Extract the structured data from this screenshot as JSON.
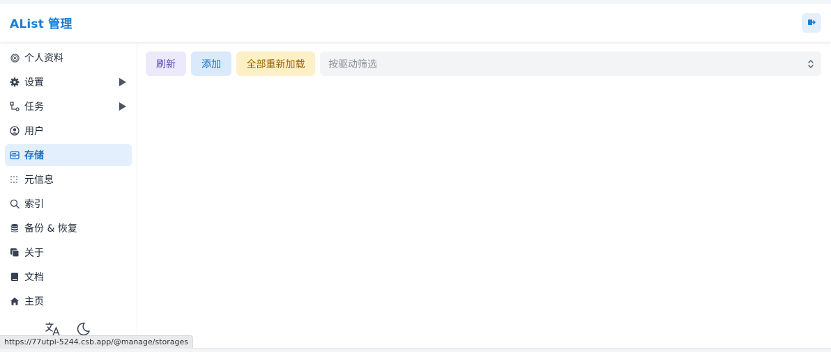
{
  "header": {
    "title": "AList 管理",
    "logout_icon": "logout-icon"
  },
  "accent_color": "#1a7fd4",
  "sidebar": {
    "items": [
      {
        "label": "个人资料",
        "icon": "fingerprint-icon",
        "has_children": false,
        "active": false
      },
      {
        "label": "设置",
        "icon": "gear-icon",
        "has_children": true,
        "active": false
      },
      {
        "label": "任务",
        "icon": "workflow-icon",
        "has_children": true,
        "active": false
      },
      {
        "label": "用户",
        "icon": "user-circle-icon",
        "has_children": false,
        "active": false
      },
      {
        "label": "存储",
        "icon": "storage-icon",
        "has_children": false,
        "active": true
      },
      {
        "label": "元信息",
        "icon": "meta-icon",
        "has_children": false,
        "active": false
      },
      {
        "label": "索引",
        "icon": "search-icon",
        "has_children": false,
        "active": false
      },
      {
        "label": "备份 & 恢复",
        "icon": "database-icon",
        "has_children": false,
        "active": false
      },
      {
        "label": "关于",
        "icon": "copy-icon",
        "has_children": false,
        "active": false
      },
      {
        "label": "文档",
        "icon": "book-icon",
        "has_children": false,
        "active": false
      },
      {
        "label": "主页",
        "icon": "home-icon",
        "has_children": false,
        "active": false
      }
    ],
    "bottom": {
      "language_icon": "translate-icon",
      "theme_icon": "moon-icon"
    }
  },
  "toolbar": {
    "refresh_label": "刷新",
    "add_label": "添加",
    "reload_all_label": "全部重新加载",
    "filter_placeholder": "按驱动筛选"
  },
  "statusbar": {
    "url": "https://77utpi-5244.csb.app/@manage/storages"
  }
}
